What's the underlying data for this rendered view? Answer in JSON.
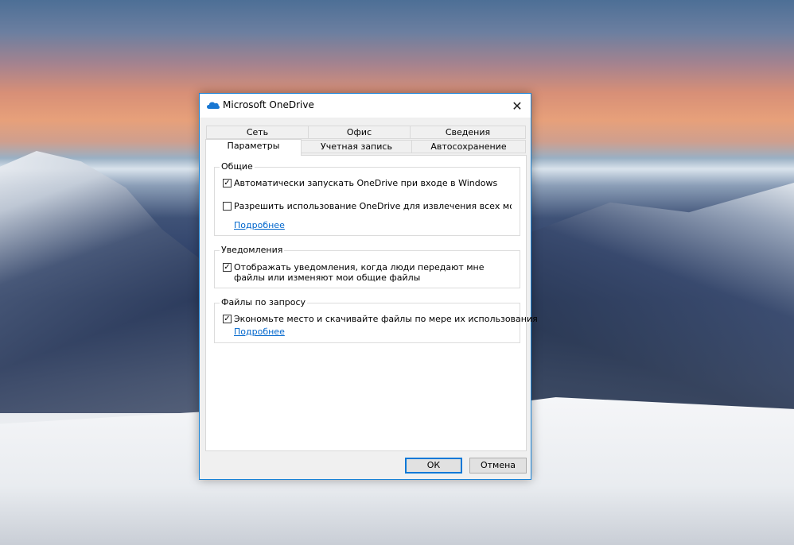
{
  "window": {
    "title": "Microsoft OneDrive",
    "close_glyph": "✕"
  },
  "tabs_top": [
    "Сеть",
    "Офис",
    "Сведения"
  ],
  "tabs_bottom": [
    "Параметры",
    "Учетная запись",
    "Автосохранение"
  ],
  "general": {
    "title": "Общие",
    "autostart_label": "Автоматически запускать OneDrive при входе в Windows",
    "autostart_checked": true,
    "fetch_label": "Разрешить использование OneDrive для извлечения всех моих файлов",
    "fetch_checked": false,
    "more_link": "Подробнее"
  },
  "notifications": {
    "title": "Уведомления",
    "notify_label": "Отображать уведомления, когда люди передают мне файлы или изменяют мои общие файлы",
    "notify_checked": true
  },
  "files_on_demand": {
    "title": "Файлы по запросу",
    "save_space_label": "Экономьте место и скачивайте файлы по мере их использования",
    "save_space_checked": true,
    "more_link": "Подробнее"
  },
  "buttons": {
    "ok": "ОК",
    "cancel": "Отмена"
  },
  "colors": {
    "accent": "#0078d7",
    "link": "#0066cc",
    "dialog_bg": "#f0f0f0"
  },
  "icons": {
    "app": "onedrive-cloud-icon",
    "close": "close-icon",
    "check": "checkmark-icon"
  }
}
